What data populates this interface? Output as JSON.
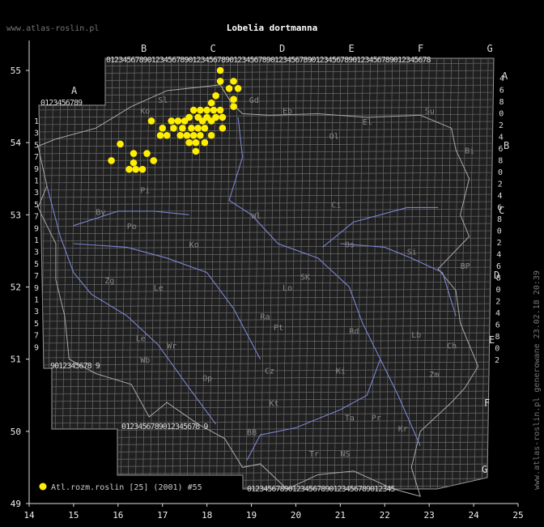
{
  "site": "www.atlas-roslin.pl",
  "title": "Lobelia dortmanna",
  "generated_note": "www.atlas-roslin.pl generowane 23.02.18 20:39",
  "axes": {
    "x_ticks": [
      "14",
      "15",
      "16",
      "17",
      "18",
      "19",
      "20",
      "21",
      "22",
      "23",
      "24",
      "25"
    ],
    "y_ticks": [
      "55",
      "54",
      "53",
      "52",
      "51",
      "50",
      "49"
    ]
  },
  "legend": {
    "label": "Atl.rozm.roslin [25] (2001) #55",
    "color": "#ffee00"
  },
  "grid": {
    "top_letters": [
      "B",
      "C",
      "D",
      "E",
      "F",
      "G"
    ],
    "top_digits": "0123456789012345678901234567890123456789012345678901234567890123456789012345678",
    "left_top_letter": "A",
    "left_top_digits": "0123456789",
    "bottom_left_digits": "9012345678 9",
    "bottom_mid_digits": "0123456789012345678 9",
    "bottom_right_digits": "012345678901234567890123456789012345",
    "left_digits": [
      "1",
      "3",
      "5",
      "7",
      "9",
      "1",
      "3",
      "5",
      "7",
      "9",
      "1",
      "3",
      "5",
      "7",
      "9",
      "1",
      "3",
      "5",
      "7",
      "9"
    ],
    "right_digits": [
      "4",
      "6",
      "8",
      "0",
      "2",
      "4",
      "6",
      "8",
      "0",
      "2",
      "4",
      "6",
      "8",
      "0",
      "2",
      "4",
      "6",
      "8",
      "0",
      "2",
      "4",
      "6",
      "8",
      "0",
      "2"
    ],
    "right_letters": [
      "A",
      "B",
      "C",
      "D",
      "E",
      "F",
      "G"
    ]
  },
  "regions": [
    "Sl",
    "Ko",
    "Gd",
    "Eb",
    "Ol",
    "Su",
    "El",
    "Bi",
    "Pi",
    "By",
    "Wl",
    "Ci",
    "Po",
    "Ko",
    "Os",
    "Si",
    "BP",
    "Zg",
    "Le",
    "SK",
    "Lo",
    "Ra",
    "Pt",
    "Rd",
    "Lb",
    "Le",
    "Wr",
    "Ch",
    "Op",
    "Wb",
    "Cz",
    "Ki",
    "Zm",
    "Kt",
    "Ta",
    "Kr",
    "Pr",
    "BB",
    "NS",
    "Tr"
  ],
  "occurrences": [
    [
      18.3,
      55.0
    ],
    [
      18.3,
      54.85
    ],
    [
      18.6,
      54.85
    ],
    [
      18.5,
      54.75
    ],
    [
      18.7,
      54.75
    ],
    [
      18.2,
      54.65
    ],
    [
      18.6,
      54.6
    ],
    [
      18.1,
      54.55
    ],
    [
      18.6,
      54.5
    ],
    [
      17.7,
      54.45
    ],
    [
      17.85,
      54.45
    ],
    [
      18.0,
      54.45
    ],
    [
      18.15,
      54.45
    ],
    [
      18.3,
      54.45
    ],
    [
      17.6,
      54.35
    ],
    [
      17.8,
      54.35
    ],
    [
      18.0,
      54.35
    ],
    [
      18.2,
      54.35
    ],
    [
      18.35,
      54.35
    ],
    [
      16.75,
      54.3
    ],
    [
      17.2,
      54.3
    ],
    [
      17.35,
      54.3
    ],
    [
      17.5,
      54.3
    ],
    [
      17.9,
      54.3
    ],
    [
      18.1,
      54.3
    ],
    [
      17.0,
      54.2
    ],
    [
      17.25,
      54.2
    ],
    [
      17.45,
      54.2
    ],
    [
      17.65,
      54.2
    ],
    [
      17.8,
      54.2
    ],
    [
      17.95,
      54.2
    ],
    [
      18.35,
      54.2
    ],
    [
      16.95,
      54.1
    ],
    [
      17.1,
      54.1
    ],
    [
      17.4,
      54.1
    ],
    [
      17.55,
      54.1
    ],
    [
      17.7,
      54.1
    ],
    [
      17.85,
      54.1
    ],
    [
      18.1,
      54.1
    ],
    [
      17.6,
      54.0
    ],
    [
      17.75,
      54.0
    ],
    [
      17.95,
      54.0
    ],
    [
      16.05,
      53.98
    ],
    [
      17.75,
      53.88
    ],
    [
      16.35,
      53.85
    ],
    [
      16.65,
      53.85
    ],
    [
      15.85,
      53.75
    ],
    [
      16.35,
      53.72
    ],
    [
      16.8,
      53.75
    ],
    [
      16.25,
      53.63
    ],
    [
      16.4,
      53.63
    ],
    [
      16.55,
      53.63
    ]
  ]
}
